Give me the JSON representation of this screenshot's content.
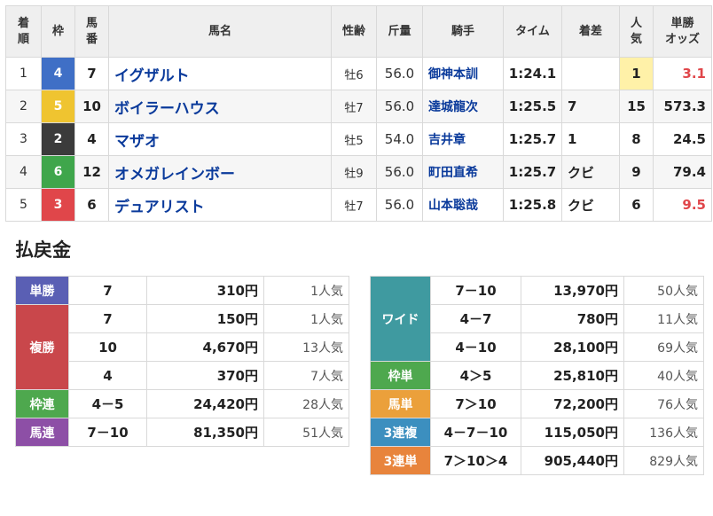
{
  "results": {
    "headers": {
      "rank": [
        "着",
        "順"
      ],
      "waku": "枠",
      "umaban": [
        "馬",
        "番"
      ],
      "horse": "馬名",
      "sexage": "性齢",
      "weight": "斤量",
      "jockey": "騎手",
      "time": "タイム",
      "margin": "着差",
      "pop": [
        "人",
        "気"
      ],
      "odds": [
        "単勝",
        "オッズ"
      ]
    },
    "rows": [
      {
        "rank": "1",
        "waku": "4",
        "waku_color": "#3f6fc6",
        "waku_text": "#ffffff",
        "umaban": "7",
        "horse": "イグザルト",
        "sexage": "牡6",
        "weight": "56.0",
        "jockey": "御神本訓",
        "time": "1:24.1",
        "margin": "",
        "pop": "1",
        "odds": "3.1",
        "odds_red": true
      },
      {
        "rank": "2",
        "waku": "5",
        "waku_color": "#efc430",
        "waku_text": "#ffffff",
        "umaban": "10",
        "horse": "ボイラーハウス",
        "sexage": "牡7",
        "weight": "56.0",
        "jockey": "達城龍次",
        "time": "1:25.5",
        "margin": "7",
        "pop": "15",
        "odds": "573.3",
        "odds_red": false
      },
      {
        "rank": "3",
        "waku": "2",
        "waku_color": "#3b3b3b",
        "waku_text": "#ffffff",
        "umaban": "4",
        "horse": "マザオ",
        "sexage": "牡5",
        "weight": "54.0",
        "jockey": "吉井章",
        "time": "1:25.7",
        "margin": "1",
        "pop": "8",
        "odds": "24.5",
        "odds_red": false
      },
      {
        "rank": "4",
        "waku": "6",
        "waku_color": "#3fa64b",
        "waku_text": "#ffffff",
        "umaban": "12",
        "horse": "オメガレインボー",
        "sexage": "牡9",
        "weight": "56.0",
        "jockey": "町田直希",
        "time": "1:25.7",
        "margin": "クビ",
        "pop": "9",
        "odds": "79.4",
        "odds_red": false
      },
      {
        "rank": "5",
        "waku": "3",
        "waku_color": "#e0464a",
        "waku_text": "#ffffff",
        "umaban": "6",
        "horse": "デュアリスト",
        "sexage": "牡7",
        "weight": "56.0",
        "jockey": "山本聡哉",
        "time": "1:25.8",
        "margin": "クビ",
        "pop": "6",
        "odds": "9.5",
        "odds_red": true
      }
    ]
  },
  "payout": {
    "title": "払戻金",
    "left": [
      {
        "label": "単勝",
        "color": "#5a5fb4",
        "rows": [
          {
            "combo": "7",
            "yen": "310円",
            "pop": "1人気"
          }
        ]
      },
      {
        "label": "複勝",
        "color": "#c9474b",
        "rows": [
          {
            "combo": "7",
            "yen": "150円",
            "pop": "1人気"
          },
          {
            "combo": "10",
            "yen": "4,670円",
            "pop": "13人気"
          },
          {
            "combo": "4",
            "yen": "370円",
            "pop": "7人気"
          }
        ]
      },
      {
        "label": "枠連",
        "color": "#4ea84e",
        "rows": [
          {
            "combo": "4－5",
            "yen": "24,420円",
            "pop": "28人気"
          }
        ]
      },
      {
        "label": "馬連",
        "color": "#8d4fa6",
        "rows": [
          {
            "combo": "7－10",
            "yen": "81,350円",
            "pop": "51人気"
          }
        ]
      }
    ],
    "right": [
      {
        "label": "ワイド",
        "color": "#3f9aa0",
        "rows": [
          {
            "combo": "7－10",
            "yen": "13,970円",
            "pop": "50人気"
          },
          {
            "combo": "4－7",
            "yen": "780円",
            "pop": "11人気"
          },
          {
            "combo": "4－10",
            "yen": "28,100円",
            "pop": "69人気"
          }
        ]
      },
      {
        "label": "枠単",
        "color": "#4ea84e",
        "rows": [
          {
            "combo": "4＞5",
            "yen": "25,810円",
            "pop": "40人気"
          }
        ]
      },
      {
        "label": "馬単",
        "color": "#eba03b",
        "rows": [
          {
            "combo": "7＞10",
            "yen": "72,200円",
            "pop": "76人気"
          }
        ]
      },
      {
        "label": "3連複",
        "color": "#3c8fbf",
        "rows": [
          {
            "combo": "4－7－10",
            "yen": "115,050円",
            "pop": "136人気"
          }
        ]
      },
      {
        "label": "3連単",
        "color": "#e8843c",
        "rows": [
          {
            "combo": "7＞10＞4",
            "yen": "905,440円",
            "pop": "829人気"
          }
        ]
      }
    ]
  }
}
